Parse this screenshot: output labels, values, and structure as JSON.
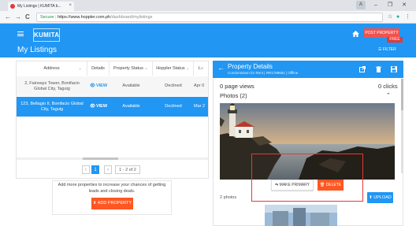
{
  "browser": {
    "tab_title": "My Listings | KUMITA b...",
    "tab_close": "×",
    "window_controls": [
      "–",
      "❐",
      "✕"
    ],
    "user_badge": "A",
    "nav": {
      "back": "←",
      "forward": "→",
      "reload": "C"
    },
    "address": {
      "secure": "Secure",
      "domain": "https://www.hoppler.com.ph",
      "path": "/dashboard/mylistings"
    },
    "ext_icons": [
      "☆",
      "●",
      "⋮"
    ]
  },
  "header": {
    "logo": "KUMITA",
    "page_title": "My Listings",
    "post_button": "POST PROPERTY",
    "free_badge": "FREE",
    "filter_label": "FILTER",
    "home_icon": "home-icon"
  },
  "table": {
    "columns": [
      "Address",
      "Details",
      "Property Status",
      "Hoppler Status",
      "L"
    ],
    "rows": [
      {
        "address": "2, Fairways Tower, Bonifacio Global City, Taguig",
        "details": "VIEW",
        "property_status": "Available",
        "hoppler_status": "Declined",
        "date": "Apr 0"
      },
      {
        "address": "123, Bellagio II, Bonifacio Global City, Taguig",
        "details": "VIEW",
        "property_status": "Available",
        "hoppler_status": "Declined",
        "date": "Mar 2"
      }
    ],
    "pager": {
      "prev": "‹",
      "current": "1",
      "next": "›",
      "summary": "1 - 2 of 2"
    }
  },
  "promo": {
    "text": "Add more properties to increase your chances of getting leads and closing deals.",
    "button": "ADD PROPERTY"
  },
  "details": {
    "title": "Property Details",
    "subtitle": "Condominium for Rent | RR1789681 | Offline",
    "page_views": "0 page views",
    "clicks": "0 clicks",
    "photos_heading": "Photos (2)",
    "make_primary": "MAKE PRIMARY",
    "delete": "DELETE",
    "photo_count": "2 photos",
    "upload": "UPLOAD"
  },
  "colors": {
    "primary": "#2196f3",
    "accent": "#ff5722",
    "danger": "#e53935"
  }
}
